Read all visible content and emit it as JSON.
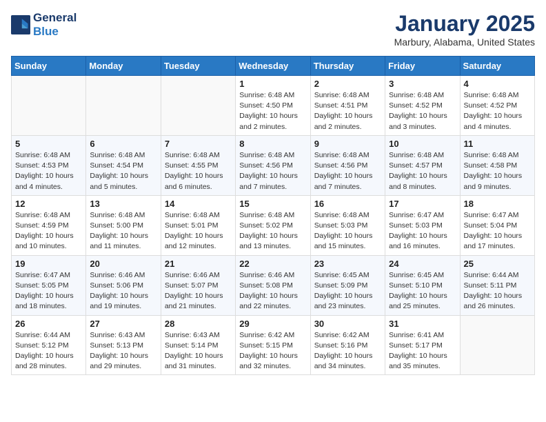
{
  "header": {
    "logo_line1": "General",
    "logo_line2": "Blue",
    "month": "January 2025",
    "location": "Marbury, Alabama, United States"
  },
  "weekdays": [
    "Sunday",
    "Monday",
    "Tuesday",
    "Wednesday",
    "Thursday",
    "Friday",
    "Saturday"
  ],
  "weeks": [
    [
      {
        "day": "",
        "info": ""
      },
      {
        "day": "",
        "info": ""
      },
      {
        "day": "",
        "info": ""
      },
      {
        "day": "1",
        "info": "Sunrise: 6:48 AM\nSunset: 4:50 PM\nDaylight: 10 hours\nand 2 minutes."
      },
      {
        "day": "2",
        "info": "Sunrise: 6:48 AM\nSunset: 4:51 PM\nDaylight: 10 hours\nand 2 minutes."
      },
      {
        "day": "3",
        "info": "Sunrise: 6:48 AM\nSunset: 4:52 PM\nDaylight: 10 hours\nand 3 minutes."
      },
      {
        "day": "4",
        "info": "Sunrise: 6:48 AM\nSunset: 4:52 PM\nDaylight: 10 hours\nand 4 minutes."
      }
    ],
    [
      {
        "day": "5",
        "info": "Sunrise: 6:48 AM\nSunset: 4:53 PM\nDaylight: 10 hours\nand 4 minutes."
      },
      {
        "day": "6",
        "info": "Sunrise: 6:48 AM\nSunset: 4:54 PM\nDaylight: 10 hours\nand 5 minutes."
      },
      {
        "day": "7",
        "info": "Sunrise: 6:48 AM\nSunset: 4:55 PM\nDaylight: 10 hours\nand 6 minutes."
      },
      {
        "day": "8",
        "info": "Sunrise: 6:48 AM\nSunset: 4:56 PM\nDaylight: 10 hours\nand 7 minutes."
      },
      {
        "day": "9",
        "info": "Sunrise: 6:48 AM\nSunset: 4:56 PM\nDaylight: 10 hours\nand 7 minutes."
      },
      {
        "day": "10",
        "info": "Sunrise: 6:48 AM\nSunset: 4:57 PM\nDaylight: 10 hours\nand 8 minutes."
      },
      {
        "day": "11",
        "info": "Sunrise: 6:48 AM\nSunset: 4:58 PM\nDaylight: 10 hours\nand 9 minutes."
      }
    ],
    [
      {
        "day": "12",
        "info": "Sunrise: 6:48 AM\nSunset: 4:59 PM\nDaylight: 10 hours\nand 10 minutes."
      },
      {
        "day": "13",
        "info": "Sunrise: 6:48 AM\nSunset: 5:00 PM\nDaylight: 10 hours\nand 11 minutes."
      },
      {
        "day": "14",
        "info": "Sunrise: 6:48 AM\nSunset: 5:01 PM\nDaylight: 10 hours\nand 12 minutes."
      },
      {
        "day": "15",
        "info": "Sunrise: 6:48 AM\nSunset: 5:02 PM\nDaylight: 10 hours\nand 13 minutes."
      },
      {
        "day": "16",
        "info": "Sunrise: 6:48 AM\nSunset: 5:03 PM\nDaylight: 10 hours\nand 15 minutes."
      },
      {
        "day": "17",
        "info": "Sunrise: 6:47 AM\nSunset: 5:03 PM\nDaylight: 10 hours\nand 16 minutes."
      },
      {
        "day": "18",
        "info": "Sunrise: 6:47 AM\nSunset: 5:04 PM\nDaylight: 10 hours\nand 17 minutes."
      }
    ],
    [
      {
        "day": "19",
        "info": "Sunrise: 6:47 AM\nSunset: 5:05 PM\nDaylight: 10 hours\nand 18 minutes."
      },
      {
        "day": "20",
        "info": "Sunrise: 6:46 AM\nSunset: 5:06 PM\nDaylight: 10 hours\nand 19 minutes."
      },
      {
        "day": "21",
        "info": "Sunrise: 6:46 AM\nSunset: 5:07 PM\nDaylight: 10 hours\nand 21 minutes."
      },
      {
        "day": "22",
        "info": "Sunrise: 6:46 AM\nSunset: 5:08 PM\nDaylight: 10 hours\nand 22 minutes."
      },
      {
        "day": "23",
        "info": "Sunrise: 6:45 AM\nSunset: 5:09 PM\nDaylight: 10 hours\nand 23 minutes."
      },
      {
        "day": "24",
        "info": "Sunrise: 6:45 AM\nSunset: 5:10 PM\nDaylight: 10 hours\nand 25 minutes."
      },
      {
        "day": "25",
        "info": "Sunrise: 6:44 AM\nSunset: 5:11 PM\nDaylight: 10 hours\nand 26 minutes."
      }
    ],
    [
      {
        "day": "26",
        "info": "Sunrise: 6:44 AM\nSunset: 5:12 PM\nDaylight: 10 hours\nand 28 minutes."
      },
      {
        "day": "27",
        "info": "Sunrise: 6:43 AM\nSunset: 5:13 PM\nDaylight: 10 hours\nand 29 minutes."
      },
      {
        "day": "28",
        "info": "Sunrise: 6:43 AM\nSunset: 5:14 PM\nDaylight: 10 hours\nand 31 minutes."
      },
      {
        "day": "29",
        "info": "Sunrise: 6:42 AM\nSunset: 5:15 PM\nDaylight: 10 hours\nand 32 minutes."
      },
      {
        "day": "30",
        "info": "Sunrise: 6:42 AM\nSunset: 5:16 PM\nDaylight: 10 hours\nand 34 minutes."
      },
      {
        "day": "31",
        "info": "Sunrise: 6:41 AM\nSunset: 5:17 PM\nDaylight: 10 hours\nand 35 minutes."
      },
      {
        "day": "",
        "info": ""
      }
    ]
  ]
}
